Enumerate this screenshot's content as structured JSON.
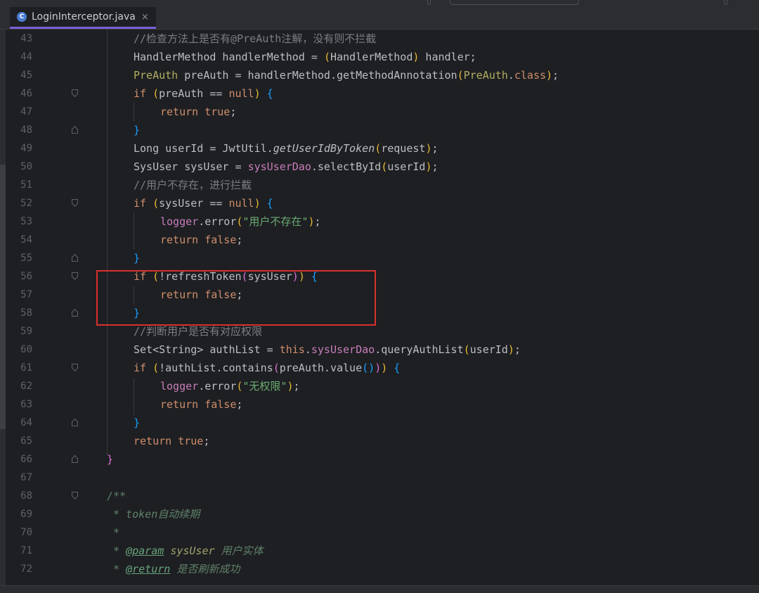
{
  "tab": {
    "label": "LoginInterceptor.java",
    "icon_letter": "C",
    "close": "×"
  },
  "lines": [
    {
      "num": "43",
      "fold": "",
      "tokens": [
        [
          "cm",
          "//检查方法上是否有@PreAuth注解，没有则不拦截"
        ]
      ],
      "indent": 1
    },
    {
      "num": "44",
      "fold": "",
      "tokens": [
        [
          "t",
          "HandlerMethod handlerMethod = "
        ],
        [
          "par1",
          "("
        ],
        [
          "t",
          "HandlerMethod"
        ],
        [
          "par1",
          ")"
        ],
        [
          "t",
          " handler;"
        ]
      ],
      "indent": 1
    },
    {
      "num": "45",
      "fold": "",
      "tokens": [
        [
          "an",
          "PreAuth"
        ],
        [
          "t",
          " preAuth = handlerMethod.getMethodAnnotation"
        ],
        [
          "par1",
          "("
        ],
        [
          "an",
          "PreAuth"
        ],
        [
          "t",
          "."
        ],
        [
          "kw",
          "class"
        ],
        [
          "par1",
          ")"
        ],
        [
          "t",
          ";"
        ]
      ],
      "indent": 1
    },
    {
      "num": "46",
      "fold": "open",
      "tokens": [
        [
          "kw",
          "if"
        ],
        [
          "t",
          " "
        ],
        [
          "par1",
          "("
        ],
        [
          "t",
          "preAuth == "
        ],
        [
          "kw",
          "null"
        ],
        [
          "par1",
          ")"
        ],
        [
          "t",
          " "
        ],
        [
          "par3",
          "{"
        ]
      ],
      "indent": 1
    },
    {
      "num": "47",
      "fold": "",
      "tokens": [
        [
          "kw",
          "return true"
        ],
        [
          "t",
          ";"
        ]
      ],
      "indent": 2
    },
    {
      "num": "48",
      "fold": "close",
      "tokens": [
        [
          "par3",
          "}"
        ]
      ],
      "indent": 1
    },
    {
      "num": "49",
      "fold": "",
      "tokens": [
        [
          "t",
          "Long userId = JwtUtil."
        ],
        [
          "itfn",
          "getUserIdByToken"
        ],
        [
          "par1",
          "("
        ],
        [
          "t",
          "request"
        ],
        [
          "par1",
          ")"
        ],
        [
          "t",
          ";"
        ]
      ],
      "indent": 1
    },
    {
      "num": "50",
      "fold": "",
      "tokens": [
        [
          "t",
          "SysUser sysUser = "
        ],
        [
          "fld",
          "sysUserDao"
        ],
        [
          "t",
          ".selectById"
        ],
        [
          "par1",
          "("
        ],
        [
          "t",
          "userId"
        ],
        [
          "par1",
          ")"
        ],
        [
          "t",
          ";"
        ]
      ],
      "indent": 1
    },
    {
      "num": "51",
      "fold": "",
      "tokens": [
        [
          "cm",
          "//用户不存在，进行拦截"
        ]
      ],
      "indent": 1
    },
    {
      "num": "52",
      "fold": "open",
      "tokens": [
        [
          "kw",
          "if"
        ],
        [
          "t",
          " "
        ],
        [
          "par1",
          "("
        ],
        [
          "t",
          "sysUser == "
        ],
        [
          "kw",
          "null"
        ],
        [
          "par1",
          ")"
        ],
        [
          "t",
          " "
        ],
        [
          "par3",
          "{"
        ]
      ],
      "indent": 1
    },
    {
      "num": "53",
      "fold": "",
      "tokens": [
        [
          "fld",
          "logger"
        ],
        [
          "t",
          ".error"
        ],
        [
          "par1",
          "("
        ],
        [
          "st",
          "\"用户不存在\""
        ],
        [
          "par1",
          ")"
        ],
        [
          "t",
          ";"
        ]
      ],
      "indent": 2
    },
    {
      "num": "54",
      "fold": "",
      "tokens": [
        [
          "kw",
          "return false"
        ],
        [
          "t",
          ";"
        ]
      ],
      "indent": 2
    },
    {
      "num": "55",
      "fold": "close",
      "tokens": [
        [
          "par3",
          "}"
        ]
      ],
      "indent": 1
    },
    {
      "num": "56",
      "fold": "open",
      "tokens": [
        [
          "kw",
          "if"
        ],
        [
          "t",
          " "
        ],
        [
          "par1",
          "("
        ],
        [
          "t",
          "!refreshToken"
        ],
        [
          "par2",
          "("
        ],
        [
          "t",
          "sysUser"
        ],
        [
          "par2",
          ")"
        ],
        [
          "par1",
          ")"
        ],
        [
          "t",
          " "
        ],
        [
          "par3",
          "{"
        ]
      ],
      "indent": 1
    },
    {
      "num": "57",
      "fold": "",
      "tokens": [
        [
          "kw",
          "return false"
        ],
        [
          "t",
          ";"
        ]
      ],
      "indent": 2
    },
    {
      "num": "58",
      "fold": "close",
      "tokens": [
        [
          "par3",
          "}"
        ]
      ],
      "indent": 1
    },
    {
      "num": "59",
      "fold": "",
      "tokens": [
        [
          "cm",
          "//判断用户是否有对应权限"
        ]
      ],
      "indent": 1
    },
    {
      "num": "60",
      "fold": "",
      "tokens": [
        [
          "t",
          "Set<String> authList = "
        ],
        [
          "kw",
          "this"
        ],
        [
          "t",
          "."
        ],
        [
          "fld",
          "sysUserDao"
        ],
        [
          "t",
          ".queryAuthList"
        ],
        [
          "par1",
          "("
        ],
        [
          "t",
          "userId"
        ],
        [
          "par1",
          ")"
        ],
        [
          "t",
          ";"
        ]
      ],
      "indent": 1
    },
    {
      "num": "61",
      "fold": "open",
      "tokens": [
        [
          "kw",
          "if"
        ],
        [
          "t",
          " "
        ],
        [
          "par1",
          "("
        ],
        [
          "t",
          "!authList.contains"
        ],
        [
          "par2",
          "("
        ],
        [
          "t",
          "preAuth.value"
        ],
        [
          "par3",
          "()"
        ],
        [
          "par2",
          ")"
        ],
        [
          "par1",
          ")"
        ],
        [
          "t",
          " "
        ],
        [
          "par3",
          "{"
        ]
      ],
      "indent": 1
    },
    {
      "num": "62",
      "fold": "",
      "tokens": [
        [
          "fld",
          "logger"
        ],
        [
          "t",
          ".error"
        ],
        [
          "par1",
          "("
        ],
        [
          "st",
          "\"无权限\""
        ],
        [
          "par1",
          ")"
        ],
        [
          "t",
          ";"
        ]
      ],
      "indent": 2
    },
    {
      "num": "63",
      "fold": "",
      "tokens": [
        [
          "kw",
          "return false"
        ],
        [
          "t",
          ";"
        ]
      ],
      "indent": 2
    },
    {
      "num": "64",
      "fold": "close",
      "tokens": [
        [
          "par3",
          "}"
        ]
      ],
      "indent": 1
    },
    {
      "num": "65",
      "fold": "",
      "tokens": [
        [
          "kw",
          "return true"
        ],
        [
          "t",
          ";"
        ]
      ],
      "indent": 1
    },
    {
      "num": "66",
      "fold": "close",
      "tokens": [
        [
          "par2",
          "}"
        ]
      ],
      "indent": 0
    },
    {
      "num": "67",
      "fold": "",
      "tokens": [],
      "indent": 0
    },
    {
      "num": "68",
      "fold": "open",
      "tokens": [
        [
          "doc",
          "/**"
        ]
      ],
      "indent": 0
    },
    {
      "num": "69",
      "fold": "",
      "tokens": [
        [
          "doc",
          " * token自动续期"
        ]
      ],
      "indent": 0
    },
    {
      "num": "70",
      "fold": "",
      "tokens": [
        [
          "doc",
          " *"
        ]
      ],
      "indent": 0
    },
    {
      "num": "71",
      "fold": "",
      "tokens": [
        [
          "doc",
          " * "
        ],
        [
          "tag",
          "@param"
        ],
        [
          "doc",
          " "
        ],
        [
          "pv",
          "sysUser"
        ],
        [
          "doc",
          " 用户实体"
        ]
      ],
      "indent": 0
    },
    {
      "num": "72",
      "fold": "",
      "tokens": [
        [
          "doc",
          " * "
        ],
        [
          "tag",
          "@return"
        ],
        [
          "doc",
          " 是否刷新成功"
        ]
      ],
      "indent": 0
    }
  ]
}
